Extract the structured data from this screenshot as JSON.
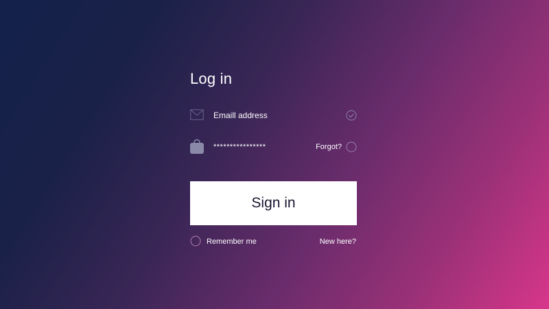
{
  "login": {
    "title": "Log in",
    "email": {
      "placeholder": "Emaill address",
      "icon": "envelope-icon",
      "status_icon": "checkmark-circle-icon"
    },
    "password": {
      "value": "****************",
      "icon": "padlock-icon",
      "forgot_label": "Forgot?",
      "status_icon": "empty-circle-icon"
    },
    "submit_label": "Sign in",
    "remember": {
      "label": "Remember me",
      "checked": false
    },
    "new_here_label": "New here?"
  },
  "colors": {
    "gradient_start": "#13214a",
    "gradient_end": "#d8368a",
    "button_bg": "#ffffff",
    "button_text": "#1a1530",
    "icon_muted": "#8a8aa8"
  }
}
